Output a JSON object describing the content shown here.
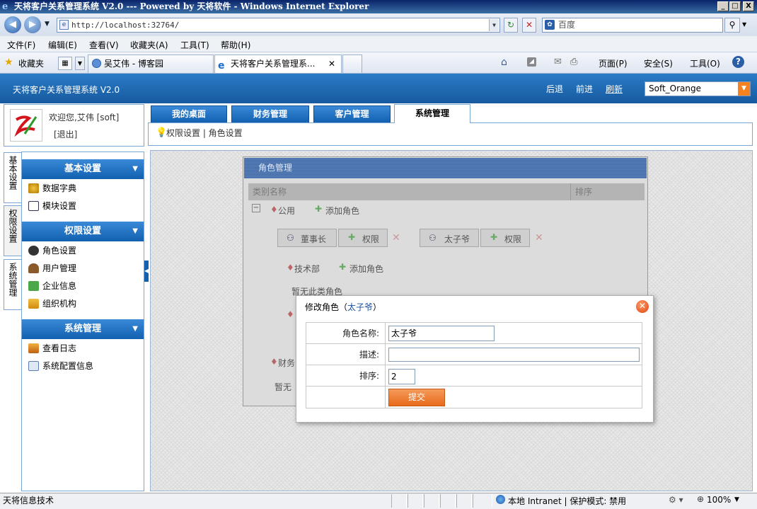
{
  "window": {
    "title": "天将客户关系管理系统 V2.0 --- Powered by 天将软件 - Windows Internet Explorer",
    "min": "_",
    "max": "□",
    "close": "X"
  },
  "browser": {
    "address": "http://localhost:32764/",
    "search_placeholder": "百度",
    "menu": [
      "文件(F)",
      "编辑(E)",
      "查看(V)",
      "收藏夹(A)",
      "工具(T)",
      "帮助(H)"
    ],
    "favorites_label": "收藏夹",
    "tabs": [
      {
        "label": "吴艾伟 - 博客园"
      },
      {
        "label": "天将客户关系管理系..."
      }
    ],
    "commandbar": {
      "page": "页面(P)",
      "safety": "安全(S)",
      "tools": "工具(O)"
    }
  },
  "app": {
    "title": "天将客户关系管理系统 V2.0",
    "header_links": {
      "back": "后退",
      "forward": "前进",
      "refresh": "刷新"
    },
    "theme": "Soft_Orange",
    "user": {
      "welcome": "欢迎您,艾伟 [soft]",
      "logout": "[退出]"
    },
    "nav_tabs": [
      "我的桌面",
      "财务管理",
      "客户管理",
      "系统管理"
    ],
    "active_nav": "系统管理",
    "breadcrumb": "权限设置 | 角色设置",
    "side_tabs": [
      "基本设置",
      "权限设置",
      "系统管理"
    ],
    "sections": [
      {
        "title": "基本设置",
        "items": [
          "数据字典",
          "模块设置"
        ]
      },
      {
        "title": "权限设置",
        "items": [
          "角色设置",
          "用户管理",
          "企业信息",
          "组织机构"
        ]
      },
      {
        "title": "系统管理",
        "items": [
          "查看日志",
          "系统配置信息"
        ]
      }
    ]
  },
  "role_panel": {
    "title": "角色管理",
    "col_category": "类别名称",
    "col_sort": "排序",
    "group_public": "公用",
    "add_role": "添加角色",
    "role1": "董事长",
    "role2": "太子爷",
    "perm": "权限",
    "dept_tech": "技术部",
    "empty_text": "暂无此类角色",
    "dept_fin_partial": "财务",
    "empty_text_partial": "暂无"
  },
  "modal": {
    "title_prefix": "修改角色（",
    "title_name": "太子爷",
    "title_suffix": "）",
    "label_name": "角色名称:",
    "label_desc": "描述:",
    "label_sort": "排序:",
    "value_name": "太子爷",
    "value_desc": "",
    "value_sort": "2",
    "submit": "提交"
  },
  "statusbar": {
    "left": "天将信息技术",
    "zone": "本地 Intranet | 保护模式: 禁用",
    "zoom": "100%"
  }
}
